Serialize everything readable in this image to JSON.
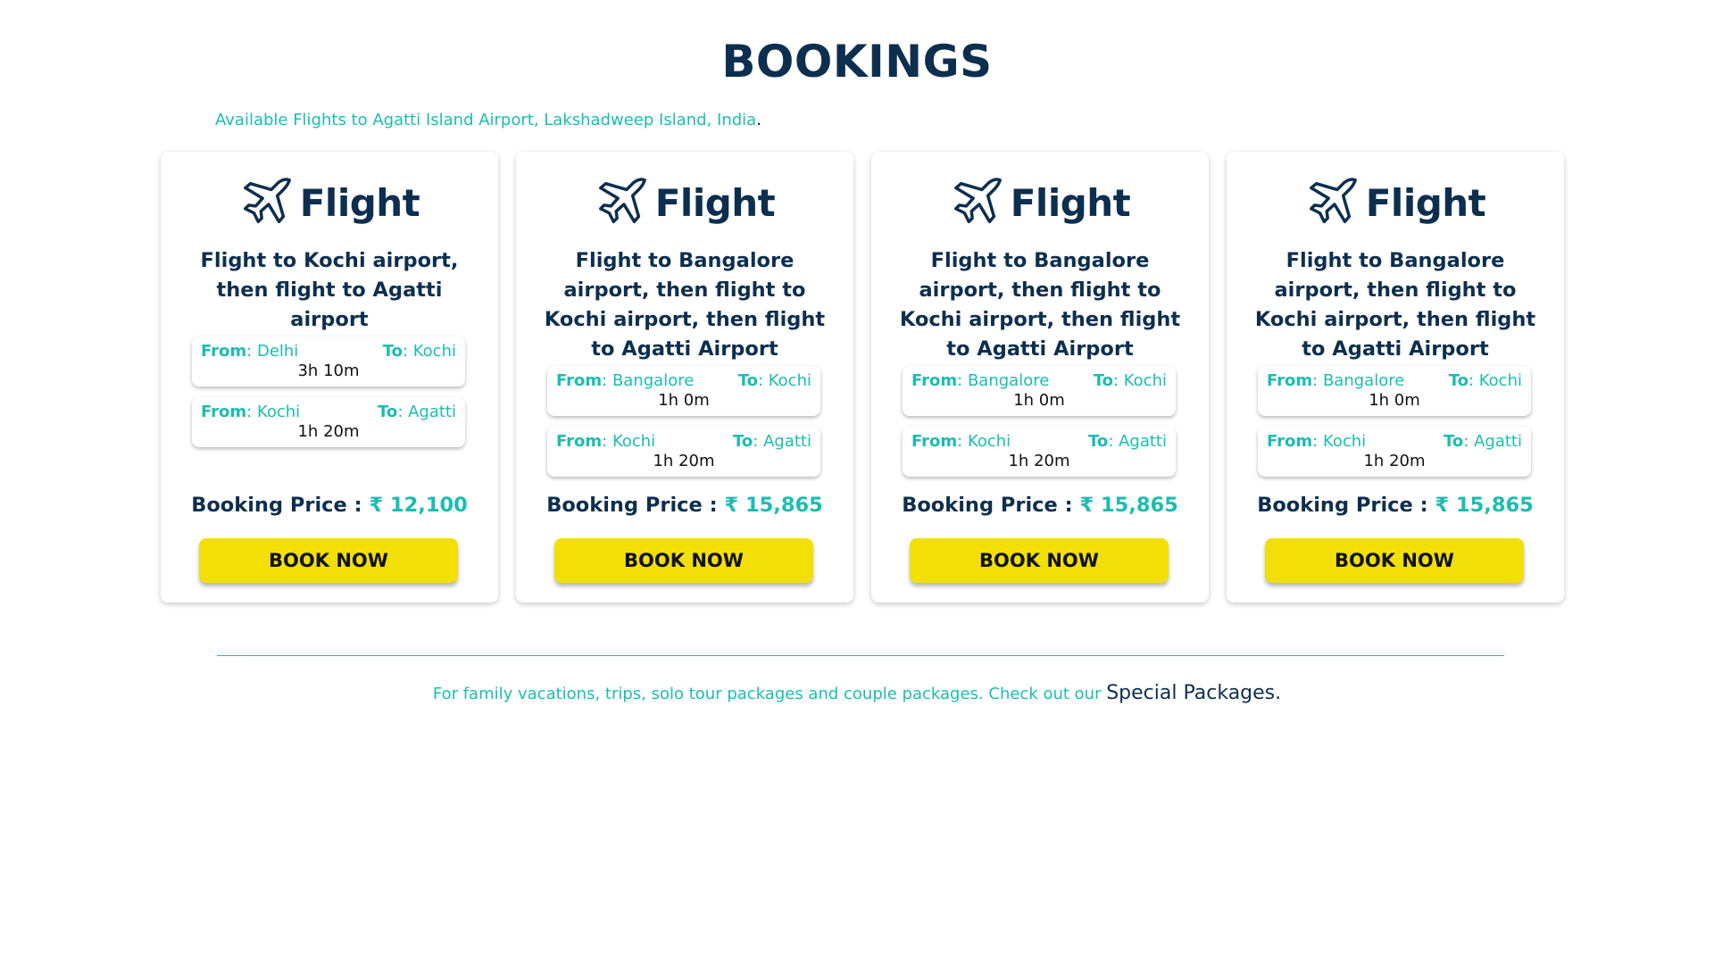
{
  "heading": "BOOKINGS",
  "subtitle": "Available Flights to Agatti Island Airport, Lakshadweep Island, India",
  "subtitle_period": ".",
  "colors": {
    "navy": "#0d2f4f",
    "teal": "#1bbdb1",
    "yellow": "#f2df08"
  },
  "cards": [
    {
      "icon": "airplane-icon",
      "label": "Flight",
      "route": "Flight to Kochi airport, then flight to Agatti airport",
      "legs": [
        {
          "from_label": "From",
          "from": "Delhi",
          "to_label": "To",
          "to": "Kochi",
          "duration": "3h 10m"
        },
        {
          "from_label": "From",
          "from": "Kochi",
          "to_label": "To",
          "to": "Agatti",
          "duration": "1h 20m"
        }
      ],
      "price_label": "Booking Price :",
      "price": "₹ 12,100",
      "button": "BOOK NOW"
    },
    {
      "icon": "airplane-icon",
      "label": "Flight",
      "route": "Flight to Bangalore airport, then flight to Kochi airport, then flight to Agatti Airport",
      "legs": [
        {
          "from_label": "From",
          "from": "Bangalore",
          "to_label": "To",
          "to": "Kochi",
          "duration": "1h 0m"
        },
        {
          "from_label": "From",
          "from": "Kochi",
          "to_label": "To",
          "to": "Agatti",
          "duration": "1h 20m"
        }
      ],
      "price_label": "Booking Price :",
      "price": "₹ 15,865",
      "button": "BOOK NOW"
    },
    {
      "icon": "airplane-icon",
      "label": "Flight",
      "route": "Flight to Bangalore airport, then flight to Kochi airport, then flight to Agatti Airport",
      "legs": [
        {
          "from_label": "From",
          "from": "Bangalore",
          "to_label": "To",
          "to": "Kochi",
          "duration": "1h 0m"
        },
        {
          "from_label": "From",
          "from": "Kochi",
          "to_label": "To",
          "to": "Agatti",
          "duration": "1h 20m"
        }
      ],
      "price_label": "Booking Price :",
      "price": "₹ 15,865",
      "button": "BOOK NOW"
    },
    {
      "icon": "airplane-icon",
      "label": "Flight",
      "route": "Flight to Bangalore airport, then flight to Kochi airport, then flight to Agatti Airport",
      "legs": [
        {
          "from_label": "From",
          "from": "Bangalore",
          "to_label": "To",
          "to": "Kochi",
          "duration": "1h 0m"
        },
        {
          "from_label": "From",
          "from": "Kochi",
          "to_label": "To",
          "to": "Agatti",
          "duration": "1h 20m"
        }
      ],
      "price_label": "Booking Price :",
      "price": "₹ 15,865",
      "button": "BOOK NOW"
    }
  ],
  "footer": {
    "text": "For family vacations, trips, solo tour packages and couple packages. Check out our ",
    "link": "Special Packages."
  }
}
